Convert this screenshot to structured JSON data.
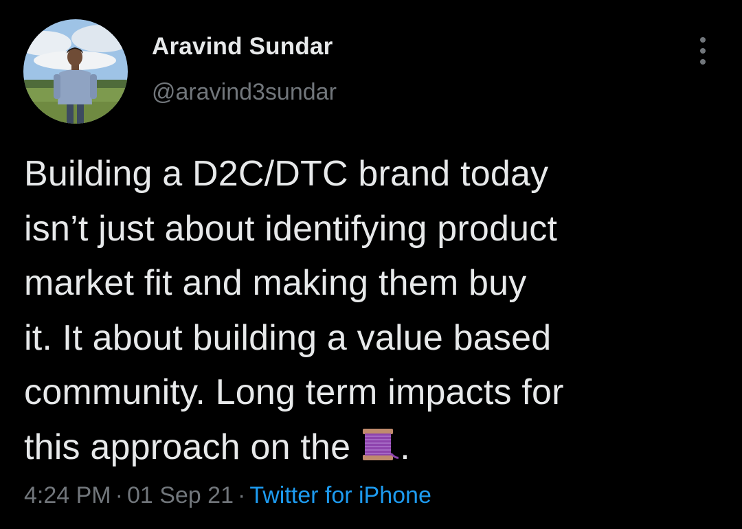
{
  "author": {
    "display_name": "Aravind Sundar",
    "handle": "@aravind3sundar"
  },
  "tweet": {
    "lines": [
      "Building a D2C/DTC brand today",
      "isn’t just about identifying product",
      "market fit and making them buy",
      "it. It about building a value based",
      "community. Long term impacts for",
      "this approach on the"
    ],
    "trailing_emoji": "thread-icon",
    "trailing_punct": "."
  },
  "meta": {
    "time": "4:24 PM",
    "date": "01 Sep 21",
    "separator": "·",
    "source": "Twitter for iPhone"
  },
  "colors": {
    "background": "#000000",
    "text_primary": "#e7e9ea",
    "text_secondary": "#71767b",
    "link": "#1d9bf0"
  },
  "icons": {
    "more": "more-options-icon",
    "emoji": "spool-of-thread-icon"
  }
}
